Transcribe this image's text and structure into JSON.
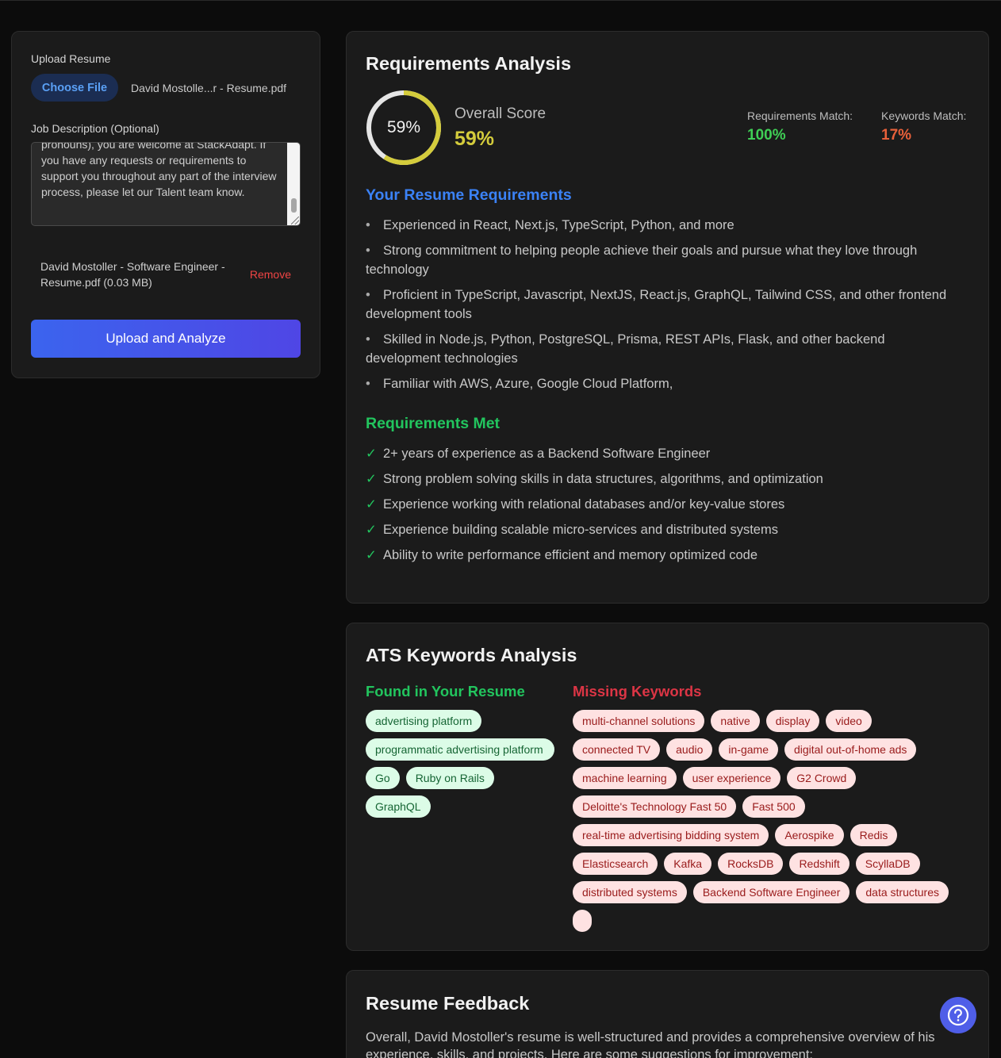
{
  "upload": {
    "label": "Upload Resume",
    "choose_label": "Choose File",
    "file_display": "David  Mostolle...r - Resume.pdf",
    "jd_label": "Job Description (Optional)",
    "jd_text": "pronouns), you are welcome at StackAdapt. If you have any requests or requirements to support you throughout any part of the interview process, please let our Talent team know.",
    "selected_file": "David Mostoller - Software Engineer - Resume.pdf (0.03 MB)",
    "remove_label": "Remove",
    "analyze_label": "Upload and Analyze"
  },
  "requirements": {
    "title": "Requirements Analysis",
    "score_text": "59%",
    "score_value": 0.59,
    "overall_label": "Overall Score",
    "overall_value": "59%",
    "req_match_label": "Requirements Match:",
    "req_match_value": "100%",
    "kw_match_label": "Keywords Match:",
    "kw_match_value": "17%",
    "your_reqs_title": "Your Resume Requirements",
    "your_reqs": [
      "Experienced in React, Next.js, TypeScript, Python, and more",
      "Strong commitment to helping people achieve their goals and pursue what they love through technology",
      "Proficient in TypeScript, Javascript, NextJS, React.js, GraphQL, Tailwind CSS, and other frontend development tools",
      "Skilled in Node.js, Python, PostgreSQL, Prisma, REST APIs, Flask, and other backend development technologies",
      "Familiar with AWS, Azure, Google Cloud Platform,"
    ],
    "met_title": "Requirements Met",
    "met": [
      "2+ years of experience as a Backend Software Engineer",
      "Strong problem solving skills in data structures, algorithms, and optimization",
      "Experience working with relational databases and/or key-value stores",
      "Experience building scalable micro-services and distributed systems",
      "Ability to write performance efficient and memory optimized code"
    ],
    "check_glyph": "✓"
  },
  "keywords": {
    "title": "ATS Keywords Analysis",
    "found_title": "Found in Your Resume",
    "found": [
      "advertising platform",
      "programmatic advertising platform",
      "Go",
      "Ruby on Rails",
      "GraphQL"
    ],
    "missing_title": "Missing Keywords",
    "missing": [
      "multi-channel solutions",
      "native",
      "display",
      "video",
      "connected TV",
      "audio",
      "in-game",
      "digital out-of-home ads",
      "machine learning",
      "user experience",
      "G2 Crowd",
      "Deloitte's Technology Fast 50",
      "Fast 500",
      "real-time advertising bidding system",
      "Aerospike",
      "Redis",
      "Elasticsearch",
      "Kafka",
      "RocksDB",
      "Redshift",
      "ScyllaDB",
      "distributed systems",
      "Backend Software Engineer",
      "data structures",
      ""
    ]
  },
  "feedback": {
    "title": "Resume Feedback",
    "text": "Overall, David Mostoller's resume is well-structured and provides a comprehensive overview of his experience, skills, and projects. Here are some suggestions for improvement:"
  },
  "colors": {
    "gauge": "#d4cc3c",
    "gauge_track": "#e5e5e5",
    "accent": "#3b82f6",
    "green": "#22c55e",
    "red": "#dc3545"
  },
  "icons": {
    "help": "help-circle-icon",
    "check": "check-icon"
  }
}
